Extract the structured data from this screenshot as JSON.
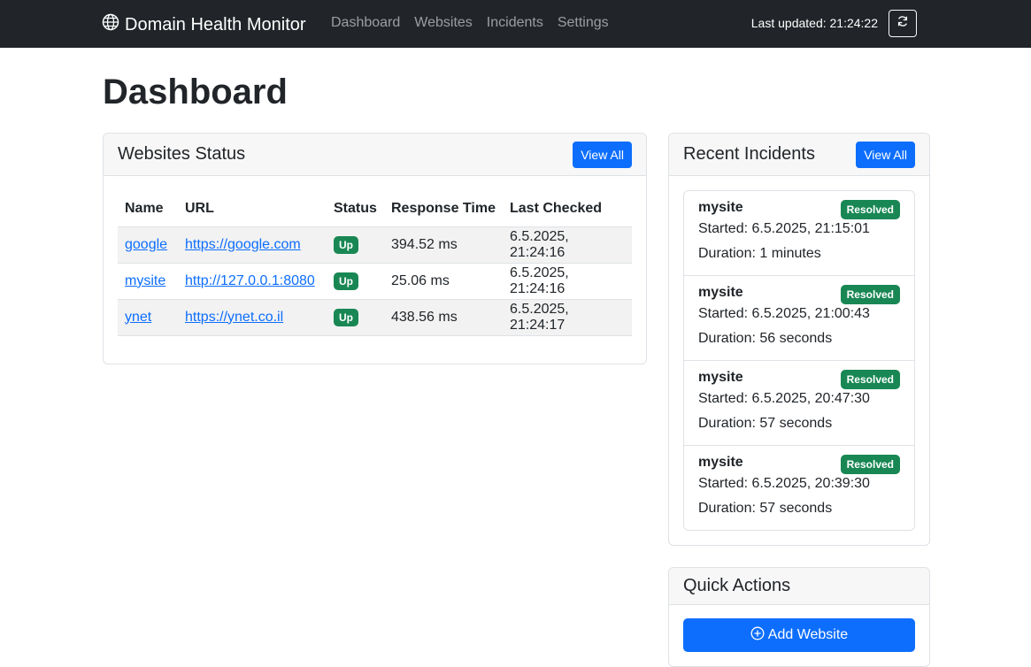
{
  "navbar": {
    "brand": "Domain Health Monitor",
    "links": [
      "Dashboard",
      "Websites",
      "Incidents",
      "Settings"
    ],
    "last_updated": "Last updated: 21:24:22"
  },
  "page_title": "Dashboard",
  "websites_card": {
    "title": "Websites Status",
    "view_all": "View All",
    "columns": [
      "Name",
      "URL",
      "Status",
      "Response Time",
      "Last Checked"
    ],
    "rows": [
      {
        "name": "google",
        "url": "https://google.com",
        "status": "Up",
        "response_time": "394.52 ms",
        "last_checked": "6.5.2025, 21:24:16"
      },
      {
        "name": "mysite",
        "url": "http://127.0.0.1:8080",
        "status": "Up",
        "response_time": "25.06 ms",
        "last_checked": "6.5.2025, 21:24:16"
      },
      {
        "name": "ynet",
        "url": "https://ynet.co.il",
        "status": "Up",
        "response_time": "438.56 ms",
        "last_checked": "6.5.2025, 21:24:17"
      }
    ]
  },
  "incidents_card": {
    "title": "Recent Incidents",
    "view_all": "View All",
    "items": [
      {
        "name": "mysite",
        "badge": "Resolved",
        "started": "Started: 6.5.2025, 21:15:01",
        "duration": "Duration: 1 minutes"
      },
      {
        "name": "mysite",
        "badge": "Resolved",
        "started": "Started: 6.5.2025, 21:00:43",
        "duration": "Duration: 56 seconds"
      },
      {
        "name": "mysite",
        "badge": "Resolved",
        "started": "Started: 6.5.2025, 20:47:30",
        "duration": "Duration: 57 seconds"
      },
      {
        "name": "mysite",
        "badge": "Resolved",
        "started": "Started: 6.5.2025, 20:39:30",
        "duration": "Duration: 57 seconds"
      }
    ]
  },
  "actions_card": {
    "title": "Quick Actions",
    "add_website": "Add Website"
  },
  "colors": {
    "navbar": "#212529",
    "primary": "#0d6efd",
    "success": "#198754"
  },
  "icons": {
    "brand": "globe-icon",
    "refresh": "refresh-icon",
    "add": "plus-circle-icon"
  }
}
